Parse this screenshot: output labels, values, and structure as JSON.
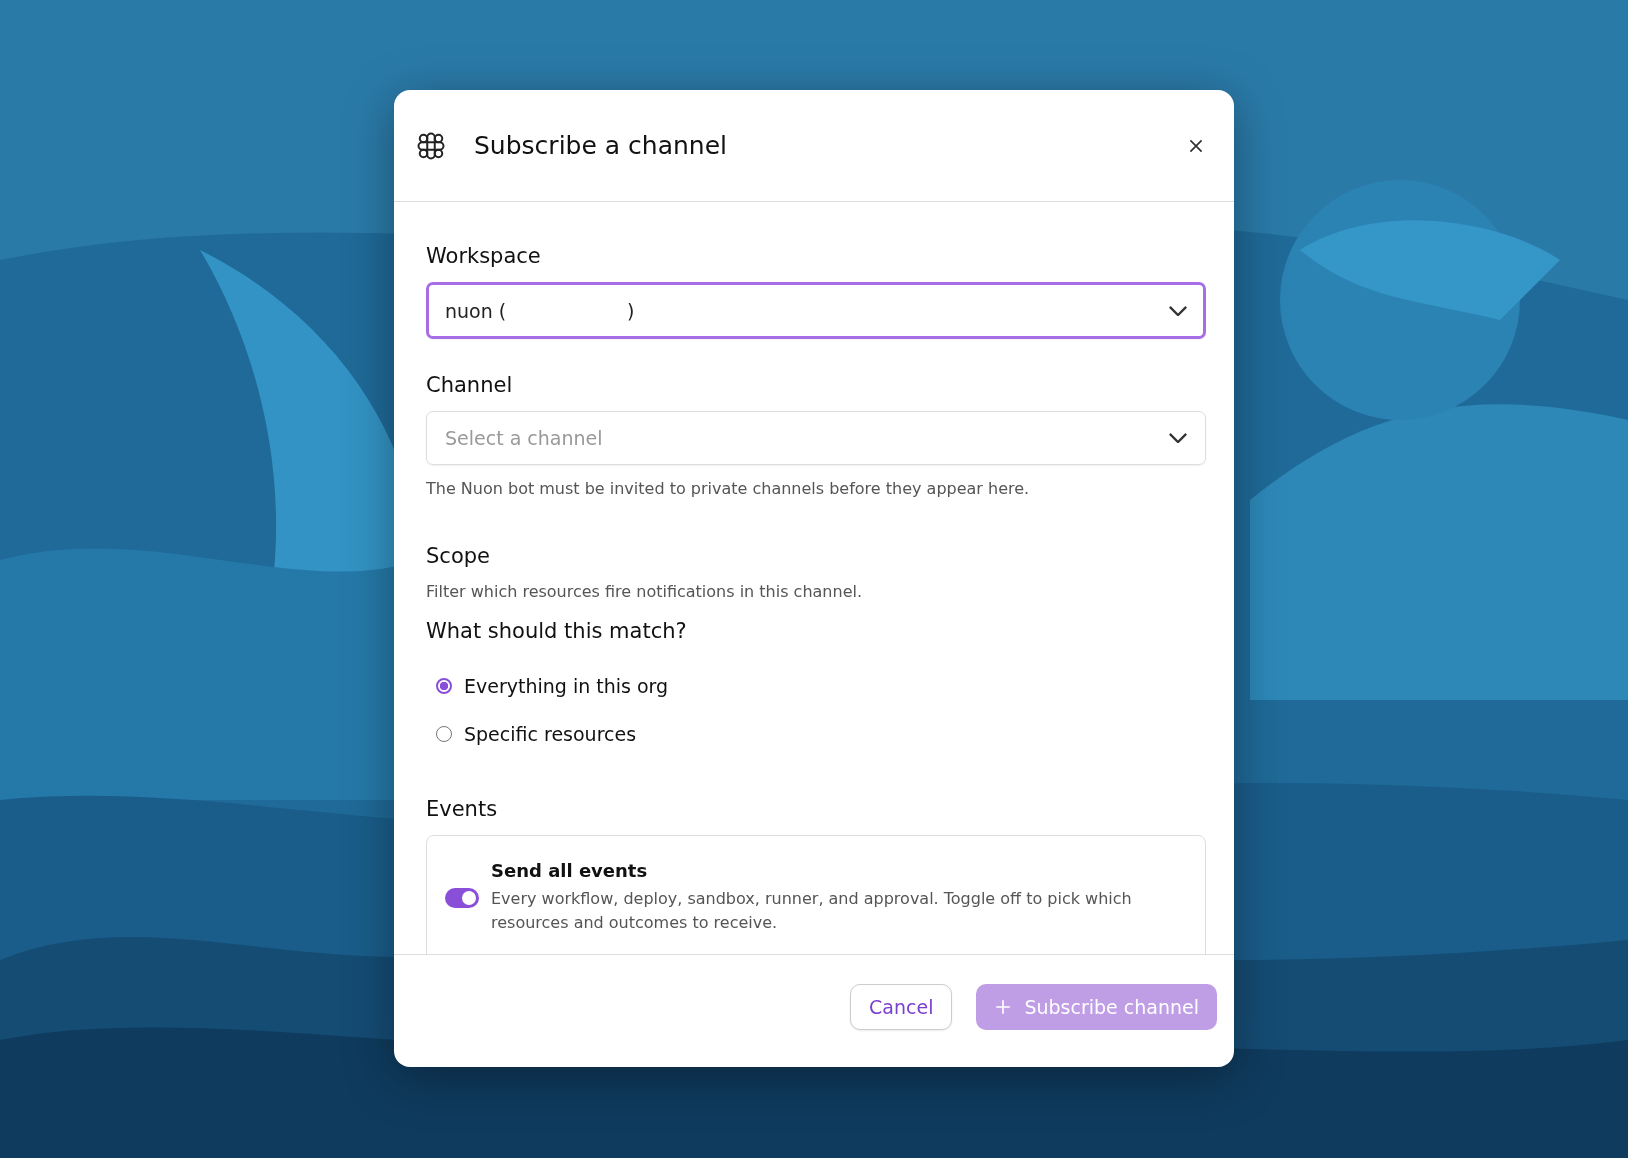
{
  "dialog": {
    "title": "Subscribe a channel"
  },
  "workspace": {
    "label": "Workspace",
    "value": "nuon (                    )",
    "focused": true
  },
  "channel": {
    "label": "Channel",
    "placeholder": "Select a channel",
    "hint": "The Nuon bot must be invited to private channels before they appear here."
  },
  "scope": {
    "title": "Scope",
    "description": "Filter which resources fire notifications in this channel.",
    "question": "What should this match?",
    "options": [
      {
        "label": "Everything in this org",
        "selected": true
      },
      {
        "label": "Specific resources",
        "selected": false
      }
    ]
  },
  "events": {
    "title": "Events",
    "toggle": {
      "label": "Send all events",
      "description": "Every workflow, deploy, sandbox, runner, and approval. Toggle off to pick which resources and outcomes to receive.",
      "on": true
    }
  },
  "buttons": [
    {
      "kind": "secondary",
      "label": "Cancel",
      "disabled": false
    },
    {
      "kind": "primary",
      "label": "Subscribe channel",
      "disabled": true
    }
  ]
}
